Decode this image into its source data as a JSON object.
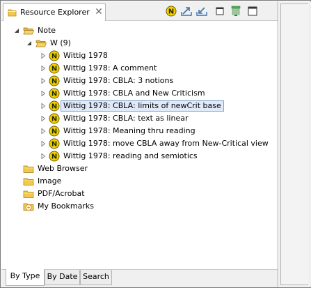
{
  "view": {
    "title": "Resource Explorer",
    "tab_icon": "folder-icon",
    "close_icon": "close-icon",
    "toolbar": [
      {
        "name": "new-note-icon"
      },
      {
        "name": "export-icon"
      },
      {
        "name": "import-icon"
      },
      {
        "name": "minimize-icon"
      },
      {
        "name": "filter-icon"
      },
      {
        "name": "maximize-icon"
      }
    ]
  },
  "tree": {
    "root": {
      "label": "Note",
      "expanded": true
    },
    "group": {
      "label": "W (9)",
      "expanded": true
    },
    "notes": [
      {
        "label": "Wittig 1978",
        "selected": false
      },
      {
        "label": "Wittig 1978: A comment",
        "selected": false
      },
      {
        "label": "Wittig 1978: CBLA: 3 notions",
        "selected": false
      },
      {
        "label": "Wittig 1978: CBLA and New Criticism",
        "selected": false
      },
      {
        "label": "Wittig 1978: CBLA: limits of newCrit base",
        "selected": true
      },
      {
        "label": "Wittig 1978: CBLA: text as linear",
        "selected": false
      },
      {
        "label": "Wittig 1978: Meaning thru reading",
        "selected": false
      },
      {
        "label": "Wittig 1978: move CBLA away from New-Critical view",
        "selected": false
      },
      {
        "label": "Wittig 1978: reading and semiotics",
        "selected": false
      }
    ],
    "other_roots": [
      {
        "label": "Web Browser",
        "icon": "folder-icon"
      },
      {
        "label": "Image",
        "icon": "folder-icon"
      },
      {
        "label": "PDF/Acrobat",
        "icon": "folder-icon"
      },
      {
        "label": "My Bookmarks",
        "icon": "bookmark-folder-icon"
      }
    ]
  },
  "bottom_tabs": [
    {
      "label": "By Type",
      "active": true
    },
    {
      "label": "By Date",
      "active": false
    },
    {
      "label": "Search",
      "active": false
    }
  ],
  "colors": {
    "selection_bg": "#dfe9f7",
    "selection_border": "#7da2ce",
    "folder": "#f2c94c",
    "note_badge": "#f5d000"
  }
}
